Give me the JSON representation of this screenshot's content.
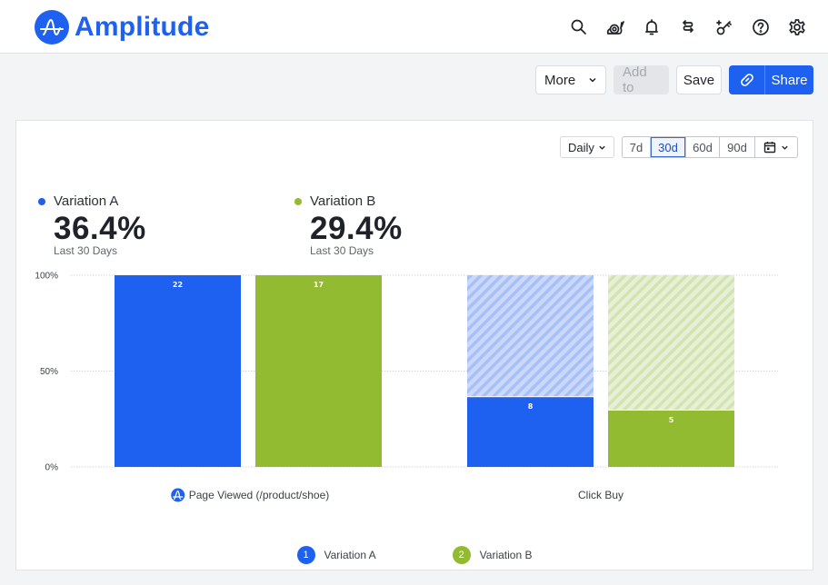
{
  "app": {
    "name": "Amplitude",
    "brand_color": "#1e61f0"
  },
  "nav": {
    "icons": [
      {
        "name": "search-icon",
        "label": "Search"
      },
      {
        "name": "snail-icon",
        "label": "Release notes"
      },
      {
        "name": "bell-icon",
        "label": "Notifications"
      },
      {
        "name": "sync-icon",
        "label": "Data"
      },
      {
        "name": "key-icon",
        "label": "Access"
      },
      {
        "name": "help-icon",
        "label": "Help"
      },
      {
        "name": "gear-icon",
        "label": "Settings"
      }
    ]
  },
  "toolbar": {
    "more_label": "More",
    "add_to_label": "Add to",
    "save_label": "Save",
    "share_label": "Share"
  },
  "controls": {
    "interval": "Daily",
    "ranges": [
      "7d",
      "30d",
      "60d",
      "90d"
    ],
    "active_range": "30d"
  },
  "metrics": [
    {
      "label": "Variation A",
      "value": "36.4%",
      "sub": "Last 30 Days",
      "color": "#1e61f0"
    },
    {
      "label": "Variation B",
      "value": "29.4%",
      "sub": "Last 30 Days",
      "color": "#93bb31"
    }
  ],
  "legend": [
    {
      "index": "1",
      "label": "Variation A",
      "color": "#1e61f0"
    },
    {
      "index": "2",
      "label": "Variation B",
      "color": "#93bb31"
    }
  ],
  "chart_data": {
    "type": "bar",
    "subtype": "funnel-grouped",
    "categories": [
      "Page Viewed (/product/shoe)",
      "Click Buy"
    ],
    "series": [
      {
        "name": "Variation A",
        "color": "#1e61f0",
        "percent": [
          100,
          36.4
        ],
        "counts": [
          22,
          8
        ]
      },
      {
        "name": "Variation B",
        "color": "#93bb31",
        "percent": [
          100,
          29.4
        ],
        "counts": [
          17,
          5
        ]
      }
    ],
    "yticks": [
      "0%",
      "50%",
      "100%"
    ],
    "ylim": [
      0,
      100
    ],
    "grid": true,
    "legend": "bottom-center",
    "dropoff_pattern": "hatched"
  }
}
